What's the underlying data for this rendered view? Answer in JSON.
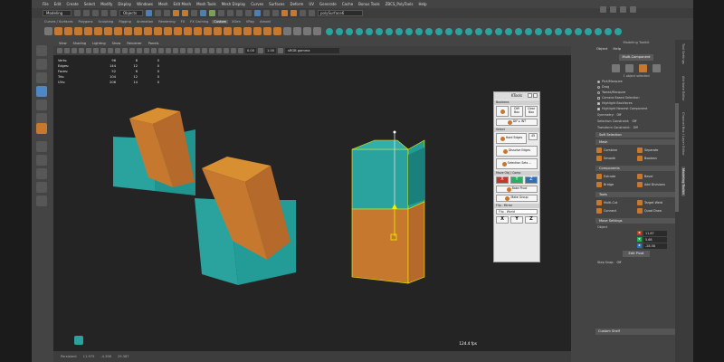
{
  "menubar": [
    "File",
    "Edit",
    "Create",
    "Select",
    "Modify",
    "Display",
    "Windows",
    "Mesh",
    "Edit Mesh",
    "Mesh Tools",
    "Mesh Display",
    "Curves",
    "Surfaces",
    "Deform",
    "UV",
    "Generate",
    "Cache",
    "Bonus Tools",
    "ZBCS_PolyTools",
    "Help"
  ],
  "statusline": {
    "mode": "Modeling",
    "objects": "Objects",
    "search": "polySurface6"
  },
  "shelf_tabs": {
    "items": [
      "Curves / Surfaces",
      "Polygons",
      "Sculpting",
      "Rigging",
      "Animation",
      "Rendering",
      "FX",
      "FX Caching",
      "Custom",
      "XGen",
      "VRay",
      "Arnold"
    ],
    "active": "Custom"
  },
  "panel_menu": [
    "View",
    "Shading",
    "Lighting",
    "Show",
    "Renderer",
    "Panels"
  ],
  "panel_tools": {
    "value1": "0.00",
    "value2": "1.00",
    "colorspace": "sRGB gamma"
  },
  "hud": [
    {
      "label": "Verts:",
      "v1": "96",
      "v2": "8",
      "v3": "0"
    },
    {
      "label": "Edges:",
      "v1": "144",
      "v2": "12",
      "v3": "0"
    },
    {
      "label": "Faces:",
      "v1": "52",
      "v2": "6",
      "v3": "0"
    },
    {
      "label": "Tris:",
      "v1": "104",
      "v2": "12",
      "v3": "0"
    },
    {
      "label": "UVs:",
      "v1": "206",
      "v2": "14",
      "v3": "0"
    }
  ],
  "fps": "124.4 fps",
  "bottom_bar": {
    "title": "Persistent",
    "v1": "11.975",
    "v2": "-4.398",
    "v3": "29.387"
  },
  "ktools": {
    "title": "KTools",
    "booleans": "Booleans",
    "boolean_btn": "",
    "diff_box": "Diff Box",
    "clear_box": "Clear Box",
    "dif_int": "DIF ▸ INT",
    "select": "Select",
    "hard_edges": "Hard Edges",
    "hard_edges_val": "45",
    "dissolve_edges": "Dissolve Edges",
    "selection_sets": "Selection Sets ...",
    "move_obj": "Move Obj / Comp",
    "x": "X",
    "y": "Y",
    "z": "Z",
    "bake_pivot": "Bake Pivot",
    "make_group": "Make Group",
    "flip": "Flip - Mirror",
    "flip_dd": "Flip - World"
  },
  "right_panel": {
    "title": "Modeling Toolkit",
    "tabs": [
      "Object",
      "Help"
    ],
    "multi_component": "Multi-Component",
    "selected": "1 object selected",
    "options": [
      {
        "label": "Pick/Marquee",
        "type": "radio",
        "on": true
      },
      {
        "label": "Drag",
        "type": "radio",
        "on": false
      },
      {
        "label": "Tweak/Marquee",
        "type": "radio",
        "on": false
      },
      {
        "label": "Camera Based Selection",
        "type": "check",
        "on": false
      },
      {
        "label": "Highlight Backfaces",
        "type": "check",
        "on": true
      },
      {
        "label": "Highlight Nearest Component",
        "type": "check",
        "on": true
      }
    ],
    "symmetry": {
      "label": "Symmetry:",
      "value": "Off"
    },
    "sel_constraint": {
      "label": "Selection Constraint:",
      "value": "Off"
    },
    "trans_constraint": {
      "label": "Transform Constraint:",
      "value": "Off"
    },
    "soft_selection": "Soft Selection",
    "mesh": {
      "title": "Mesh",
      "items": [
        "Combine",
        "Separate",
        "Smooth",
        "Boolean"
      ]
    },
    "components": {
      "title": "Components",
      "items": [
        "Extrude",
        "Bevel",
        "Bridge",
        "Add Divisions"
      ]
    },
    "tools": {
      "title": "Tools",
      "items": [
        "Multi-Cut",
        "Target Weld",
        "Connect",
        "Quad Draw"
      ]
    },
    "move_settings": "Move Settings",
    "object": "Object",
    "xyz": [
      {
        "axis": "X",
        "value": "11.87",
        "color": "#c0392b"
      },
      {
        "axis": "Y",
        "value": "5.68",
        "color": "#27ae60"
      },
      {
        "axis": "Z",
        "value": "-28.58",
        "color": "#2e6fb5"
      }
    ],
    "edit_pivot": "Edit Pivot",
    "step_snap": {
      "label": "Step Snap:",
      "value": "Off"
    },
    "custom_shelf": "Custom Shelf"
  },
  "vertical_tabs": [
    "Tool Settings",
    "Attribute Editor",
    "Channel Box / Layer Editor",
    "Modeling Toolkit"
  ],
  "colors": {
    "orange": "#c7782f",
    "teal": "#2aa39f",
    "selection": "#f0f000"
  }
}
